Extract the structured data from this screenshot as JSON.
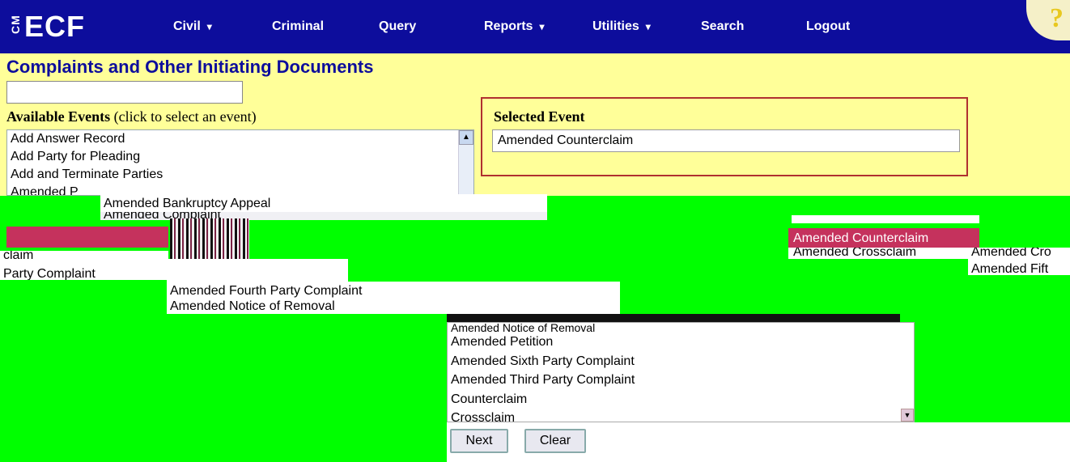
{
  "nav": {
    "logo_cm": "CM",
    "logo_ecf": "ECF",
    "items": [
      {
        "label": "Civil",
        "caret": "▾"
      },
      {
        "label": "Criminal"
      },
      {
        "label": "Query"
      },
      {
        "label": "Reports",
        "caret": "▾"
      },
      {
        "label": "Utilities",
        "caret": "▾"
      },
      {
        "label": "Search"
      },
      {
        "label": "Logout"
      }
    ],
    "help_glyph": "?"
  },
  "page": {
    "title": "Complaints and Other Initiating Documents",
    "search_value": ""
  },
  "available": {
    "label_bold": "Available Events",
    "label_rest": " (click to select an event)",
    "items": [
      "Add Answer Record",
      "Add Party for Pleading",
      "Add and Terminate Parties",
      "Amended P"
    ]
  },
  "selected": {
    "title": "Selected Event",
    "value": "Amended Counterclaim"
  },
  "fragments": {
    "bankruptcy": "Amended Bankruptcy Appeal",
    "complaint": "Amended Complaint",
    "highlight": "Amended Counterclaim",
    "crossclaim": "Amended Crossclaim",
    "claim": "claim",
    "party_complaint": "Party Complaint",
    "fourth": "Amended Fourth Party Complaint",
    "notice": "Amended Notice of Removal",
    "cro": "Amended Cro",
    "fifth": "Amended Fift"
  },
  "bottom_list": {
    "items": [
      "Amended Notice of Removal",
      "Amended Petition",
      "Amended Sixth Party Complaint",
      "Amended Third Party Complaint",
      "Counterclaim",
      "Crossclaim"
    ]
  },
  "buttons": {
    "next": "Next",
    "clear": "Clear"
  },
  "colors": {
    "nav_bg": "#0d0d9c",
    "form_bg": "#ffff99",
    "highlight": "#c5325d",
    "selected_border": "#b03030"
  }
}
